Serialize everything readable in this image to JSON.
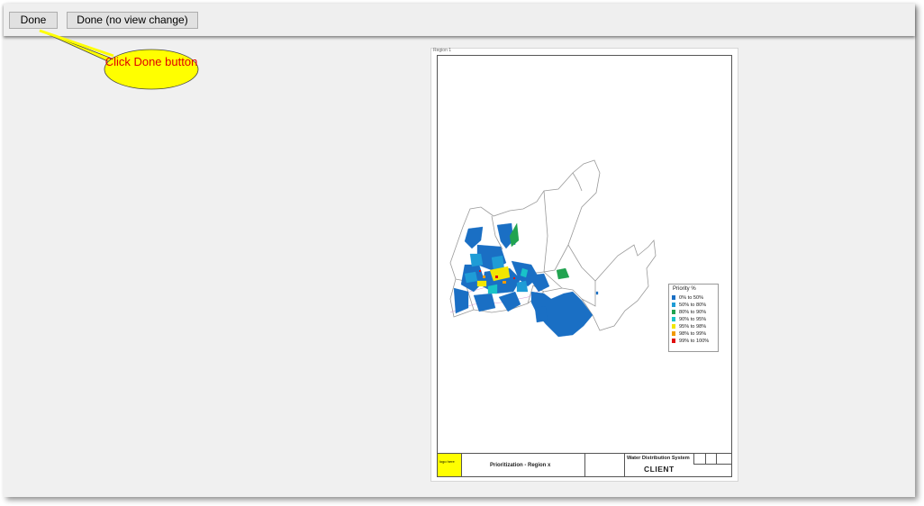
{
  "toolbar": {
    "done_label": "Done",
    "done_no_view_change_label": "Done (no view change)"
  },
  "callout": {
    "text": "Click Done button",
    "fill_color": "#ffff00",
    "text_color": "#e00000"
  },
  "sheet": {
    "label": "Region 1",
    "legend": {
      "title": "Priority %",
      "items": [
        {
          "label": "0% to 50%",
          "color": "#1a6fc4"
        },
        {
          "label": "50% to 80%",
          "color": "#1f9cd6"
        },
        {
          "label": "80% to 90%",
          "color": "#21a350"
        },
        {
          "label": "90% to 95%",
          "color": "#19c3c8"
        },
        {
          "label": "95% to 98%",
          "color": "#f2e600"
        },
        {
          "label": "98% to 99%",
          "color": "#f29a00"
        },
        {
          "label": "99% to 100%",
          "color": "#e01010"
        }
      ]
    },
    "title_block": {
      "logo_text": "logo here",
      "drawing_title": "Prioritization - Region x",
      "system_name": "Water Distribution System",
      "client": "CLIENT"
    }
  }
}
